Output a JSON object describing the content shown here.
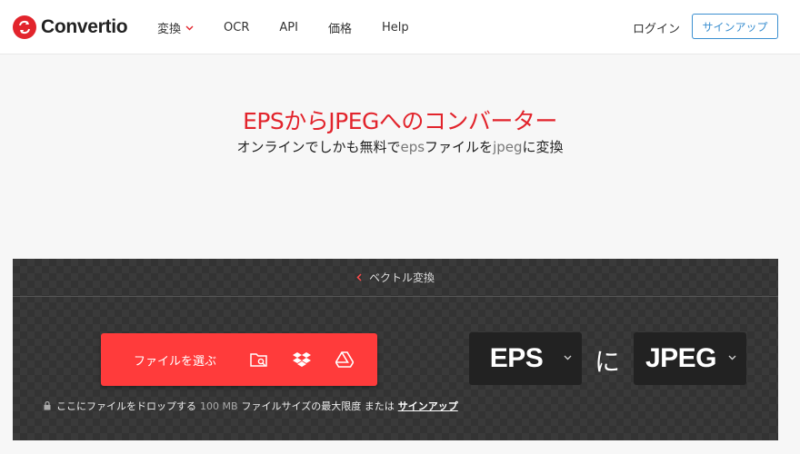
{
  "header": {
    "brand": "Convertio",
    "nav": [
      {
        "label": "変換",
        "has_dropdown": true
      },
      {
        "label": "OCR"
      },
      {
        "label": "API"
      },
      {
        "label": "価格"
      },
      {
        "label": "Help"
      }
    ],
    "login": "ログイン",
    "signup": "サインアップ"
  },
  "hero": {
    "title": "EPSからJPEGへのコンバーター",
    "subtitle_prefix": "オンラインでしかも無料で",
    "subtitle_src": "eps",
    "subtitle_mid": "ファイルを",
    "subtitle_dst": "jpeg",
    "subtitle_suffix": "に変換"
  },
  "converter": {
    "back_label": "ベクトル変換",
    "choose_files": "ファイルを選ぶ",
    "sources": [
      "folder-search-icon",
      "dropbox-icon",
      "google-drive-icon"
    ],
    "drop_note_prefix": "ここにファイルをドロップする",
    "drop_note_size": "100 MB",
    "drop_note_mid": "ファイルサイズの最大限度 または",
    "drop_note_link": "サインアップ",
    "from_format": "EPS",
    "to_word": "に",
    "to_format": "JPEG"
  },
  "colors": {
    "brand_red": "#e2242c",
    "button_red": "#ff3b3b",
    "accent_blue": "#3b8fd0",
    "panel_bg": "#3a3a3a"
  }
}
